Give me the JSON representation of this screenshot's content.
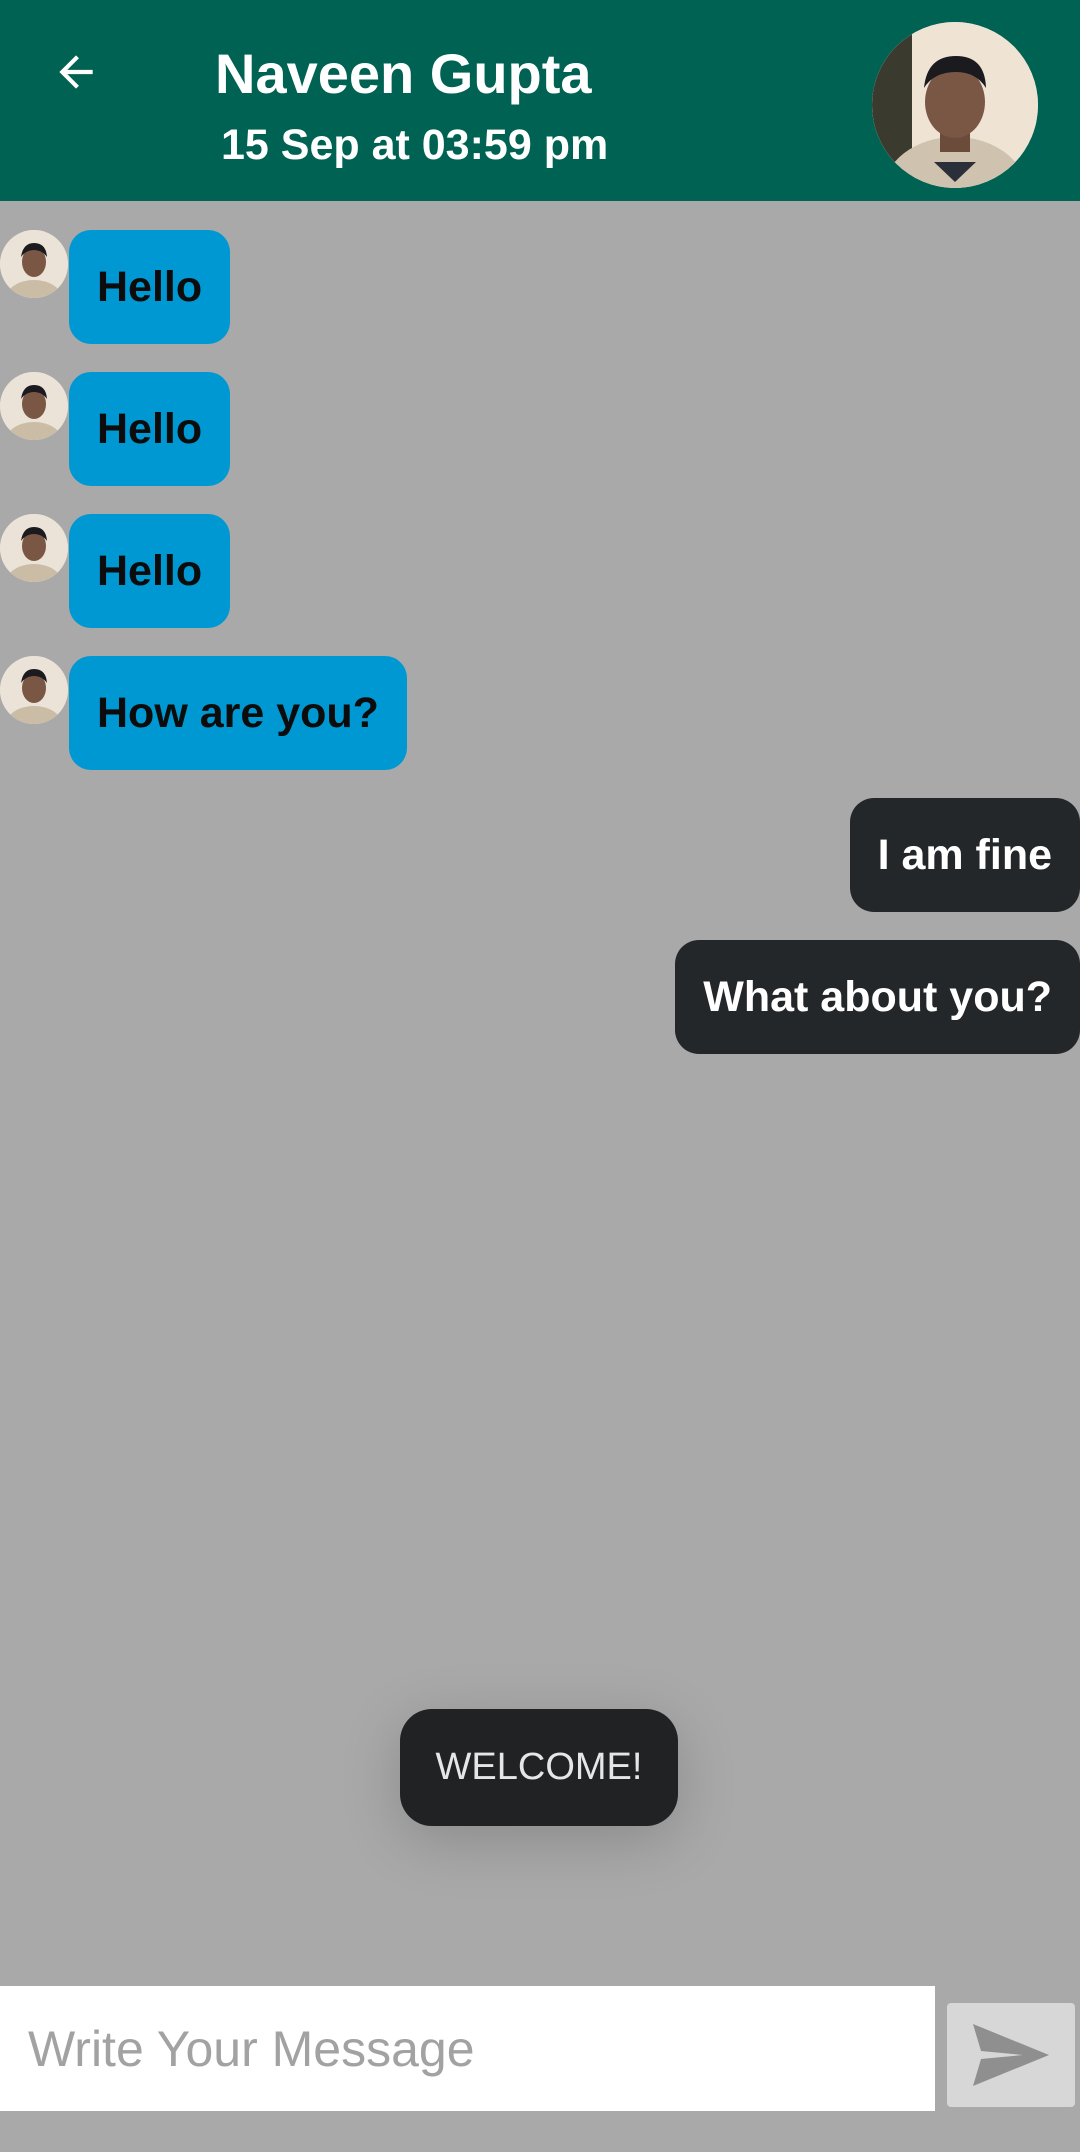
{
  "header": {
    "title": "Naveen Gupta",
    "subtitle": "15 Sep at 03:59 pm",
    "icons": {
      "back": "arrow-left-icon",
      "avatar": "contact-avatar"
    }
  },
  "messages": {
    "incoming": [
      {
        "text": "Hello"
      },
      {
        "text": "Hello"
      },
      {
        "text": "Hello"
      },
      {
        "text": "How are you?"
      }
    ],
    "outgoing": [
      {
        "text": "I am fine"
      },
      {
        "text": "What about you?"
      }
    ]
  },
  "toast": {
    "text": "WELCOME!"
  },
  "composer": {
    "placeholder": "Write Your Message",
    "value": "",
    "send_icon": "send-icon"
  },
  "colors": {
    "header": "#006253",
    "background": "#a9a9a9",
    "incoming_bubble": "#0098d2",
    "outgoing_bubble": "#24272a"
  }
}
